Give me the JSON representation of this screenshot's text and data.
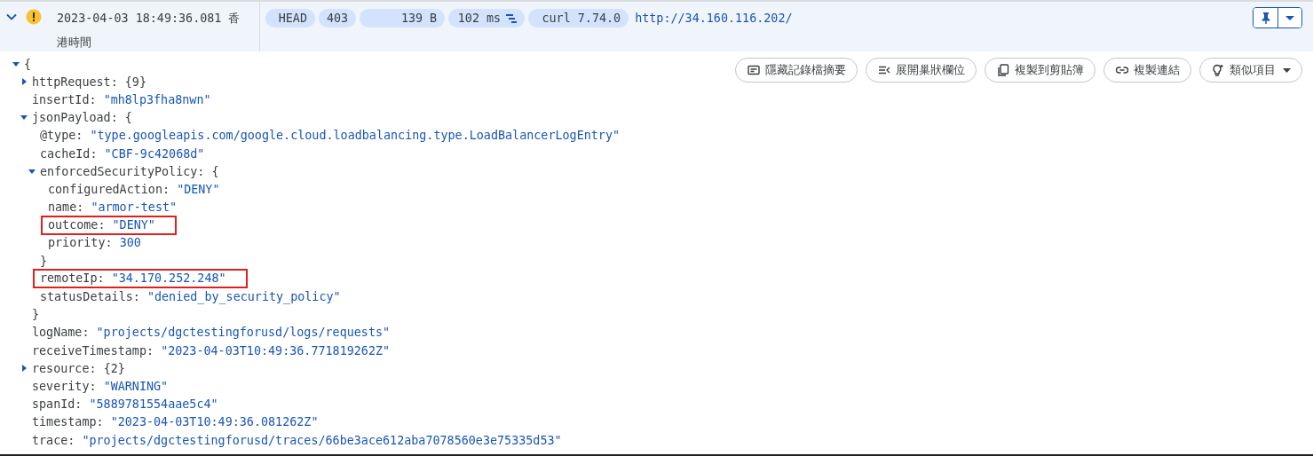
{
  "entry": {
    "expanded": true,
    "kind": "warning",
    "timestamp": "2023-04-03 18:49:36.081 香港時間",
    "chips": [
      {
        "kind": "method",
        "text": "HEAD"
      },
      {
        "kind": "status",
        "text": "403"
      },
      {
        "kind": "size",
        "text": "139 B"
      },
      {
        "kind": "latency",
        "text": "102 ms"
      },
      {
        "kind": "agent",
        "text": "curl 7.74.0"
      }
    ],
    "url": "http://34.160.116.202/",
    "pinned": true
  },
  "actions": [
    {
      "kind": "summary",
      "label": "隱藏記錄檔摘要",
      "dropdown": false
    },
    {
      "kind": "expand",
      "label": "展開巢狀欄位",
      "dropdown": false
    },
    {
      "kind": "copy",
      "label": "複製到剪貼簿",
      "dropdown": false
    },
    {
      "kind": "link",
      "label": "複製連結",
      "dropdown": false
    },
    {
      "kind": "similar",
      "label": "類似項目",
      "dropdown": true
    }
  ],
  "tree": {
    "value": "{",
    "expanded": true,
    "highlighted": false,
    "children": [
      {
        "key": "httpRequest:",
        "value": "{9}",
        "expanded": false,
        "highlighted": false
      },
      {
        "key": "insertId:",
        "value": "\"mh8lp3fha8nwn\"",
        "highlighted": false
      },
      {
        "key": "jsonPayload:",
        "value": "{",
        "expanded": true,
        "highlighted": false,
        "close": "}",
        "children": [
          {
            "key": "@type:",
            "value": "\"type.googleapis.com/google.cloud.loadbalancing.type.LoadBalancerLogEntry\"",
            "highlighted": false
          },
          {
            "key": "cacheId:",
            "value": "\"CBF-9c42068d\"",
            "highlighted": false
          },
          {
            "key": "enforcedSecurityPolicy:",
            "value": "{",
            "expanded": true,
            "highlighted": false,
            "close": "}",
            "children": [
              {
                "key": "configuredAction:",
                "value": "\"DENY\"",
                "highlighted": false
              },
              {
                "key": "name:",
                "value": "\"armor-test\"",
                "highlighted": false
              },
              {
                "key": "outcome:",
                "value": "\"DENY\"",
                "highlighted": true
              },
              {
                "key": "priority:",
                "value": "300",
                "highlighted": false
              }
            ]
          },
          {
            "key": "remoteIp:",
            "value": "\"34.170.252.248\"",
            "highlighted": true
          },
          {
            "key": "statusDetails:",
            "value": "\"denied_by_security_policy\"",
            "highlighted": false
          }
        ]
      },
      {
        "key": "logName:",
        "value": "\"projects/dgctestingforusd/logs/requests\"",
        "highlighted": false
      },
      {
        "key": "receiveTimestamp:",
        "value": "\"2023-04-03T10:49:36.771819262Z\"",
        "highlighted": false
      },
      {
        "key": "resource:",
        "value": "{2}",
        "expanded": false,
        "highlighted": false
      },
      {
        "key": "severity:",
        "value": "\"WARNING\"",
        "highlighted": false
      },
      {
        "key": "spanId:",
        "value": "\"5889781554aae5c4\"",
        "highlighted": false
      },
      {
        "key": "timestamp:",
        "value": "\"2023-04-03T10:49:36.081262Z\"",
        "highlighted": false
      },
      {
        "key": "trace:",
        "value": "\"projects/dgctestingforusd/traces/66be3ace612aba7078560e3e75335d53\"",
        "highlighted": false
      }
    ]
  }
}
